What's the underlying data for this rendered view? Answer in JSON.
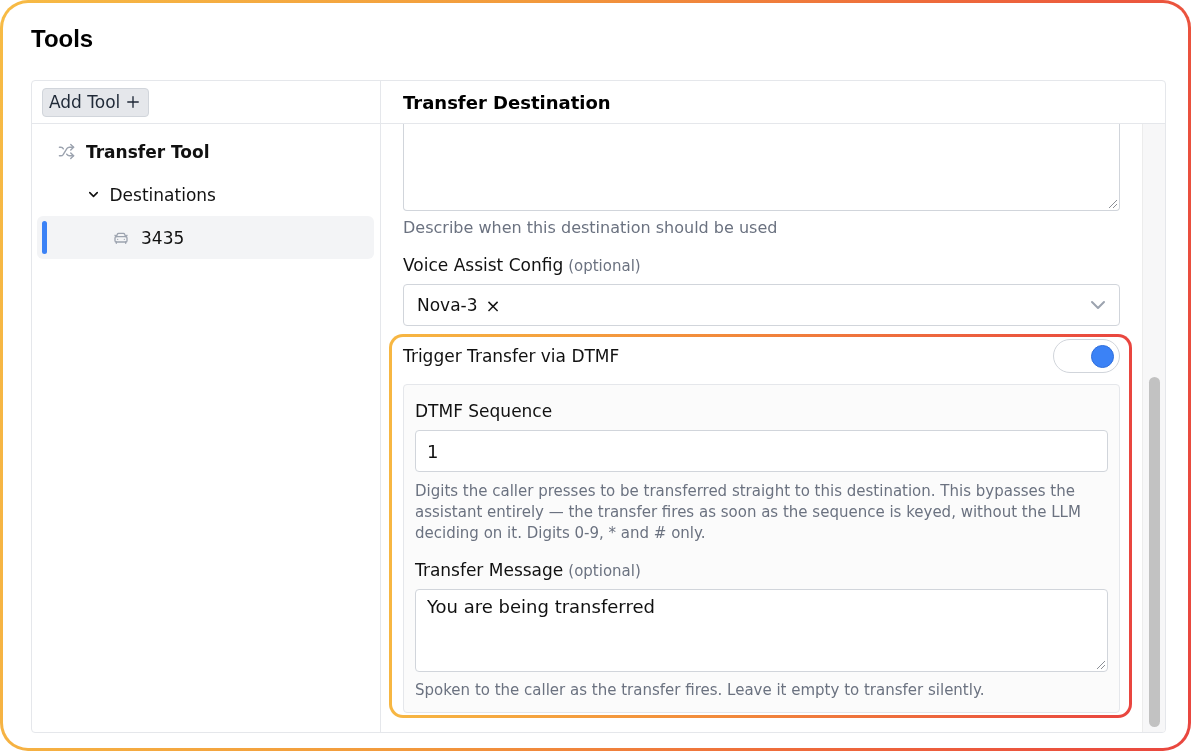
{
  "page": {
    "title": "Tools"
  },
  "sidebar": {
    "add_button": {
      "label": "Add Tool"
    },
    "tree": [
      {
        "kind": "tool",
        "label": "Transfer Tool",
        "selected": false,
        "children": [
          {
            "kind": "group",
            "label": "Destinations",
            "expanded": true,
            "selected": false,
            "children": [
              {
                "kind": "destination",
                "label": "3435",
                "selected": true
              }
            ]
          }
        ]
      }
    ]
  },
  "detail": {
    "title": "Transfer Destination",
    "description": {
      "hint": "Describe when this destination should be used"
    },
    "voice_config": {
      "label": "Voice Assist Config",
      "note": "(optional)",
      "value": "Nova-3",
      "clear": "×"
    },
    "dtmf": {
      "label": "Trigger Transfer via DTMF",
      "on": true,
      "highlighted": true,
      "sequence": {
        "label": "DTMF Sequence",
        "value": "1",
        "hint": "Digits the caller presses to be transferred straight to this destination. This bypasses the assistant entirely — the transfer fires as soon as the sequence is keyed, without the LLM deciding on it. Digits 0-9, * and # only."
      },
      "message": {
        "label": "Transfer Message",
        "note": "(optional)",
        "value": "You are being transferred",
        "hint": "Spoken to the caller as the transfer fires. Leave it empty to transfer silently."
      }
    }
  }
}
